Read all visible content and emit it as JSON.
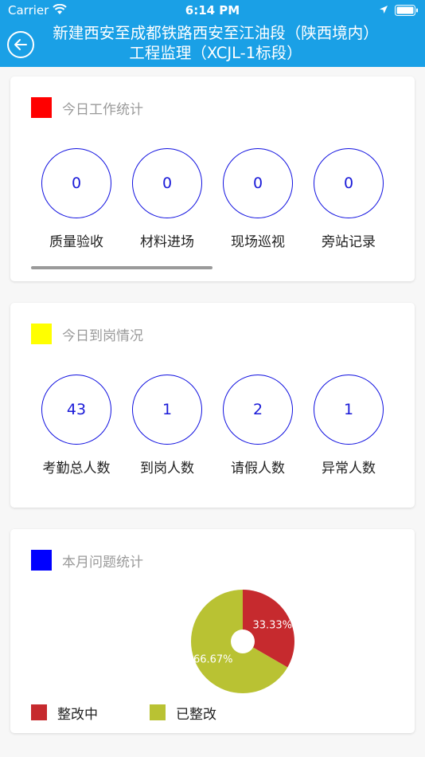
{
  "status_bar": {
    "carrier": "Carrier",
    "time": "6:14 PM"
  },
  "nav": {
    "title": "新建西安至成都铁路西安至江油段（陕西境内）工程监理（XCJL-1标段）"
  },
  "colors": {
    "nav_bg": "#1aa0e6",
    "circle_border": "#1010e0",
    "work_marker": "#ff0000",
    "attendance_marker": "#ffff00",
    "problems_marker": "#0000ff",
    "rectifying": "#c62a2e",
    "rectified": "#b9c233"
  },
  "today_work": {
    "title": "今日工作统计",
    "stats": [
      {
        "value": "0",
        "label": "质量验收"
      },
      {
        "value": "0",
        "label": "材料进场"
      },
      {
        "value": "0",
        "label": "现场巡视"
      },
      {
        "value": "0",
        "label": "旁站记录"
      }
    ]
  },
  "today_attendance": {
    "title": "今日到岗情况",
    "stats": [
      {
        "value": "43",
        "label": "考勤总人数"
      },
      {
        "value": "1",
        "label": "到岗人数"
      },
      {
        "value": "2",
        "label": "请假人数"
      },
      {
        "value": "1",
        "label": "异常人数"
      }
    ]
  },
  "monthly_problems": {
    "title": "本月问题统计",
    "legend": [
      {
        "label": "整改中"
      },
      {
        "label": "已整改"
      }
    ]
  },
  "chart_data": {
    "type": "pie",
    "categories": [
      "整改中",
      "已整改"
    ],
    "values": [
      33.33,
      66.67
    ],
    "value_labels": [
      "33.33%",
      "66.67%"
    ],
    "colors": [
      "#c62a2e",
      "#b9c233"
    ],
    "donut": true
  }
}
